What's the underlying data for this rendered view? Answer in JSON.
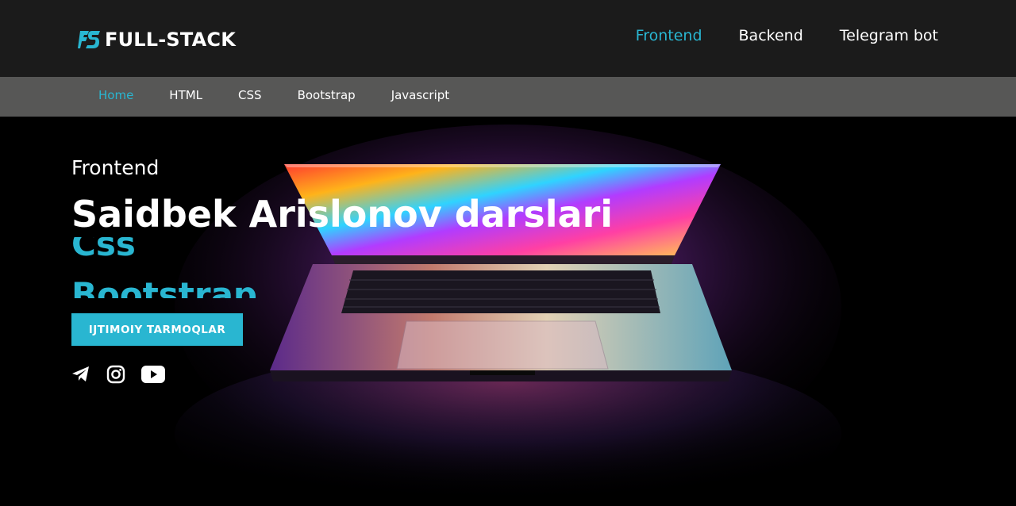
{
  "header": {
    "logo_text": "FULL-STACK",
    "logo_mark": "FS",
    "nav": [
      {
        "label": "Frontend",
        "active": true
      },
      {
        "label": "Backend",
        "active": false
      },
      {
        "label": "Telegram bot",
        "active": false
      }
    ]
  },
  "subnav": {
    "items": [
      {
        "label": "Home",
        "active": true
      },
      {
        "label": "HTML",
        "active": false
      },
      {
        "label": "CSS",
        "active": false
      },
      {
        "label": "Bootstrap",
        "active": false
      },
      {
        "label": "Javascript",
        "active": false
      }
    ]
  },
  "hero": {
    "eyebrow": "Frontend",
    "title": "Saidbek Arislonov darslari",
    "rotating_words": [
      "Css",
      "Bootstrap"
    ],
    "cta_label": "IJTIMOIY TARMOQLAR",
    "socials": [
      {
        "icon": "telegram-icon"
      },
      {
        "icon": "instagram-icon"
      },
      {
        "icon": "youtube-icon"
      }
    ]
  },
  "colors": {
    "accent": "#29b6d1",
    "header_bg": "#1b1b1b",
    "subnav_bg": "#575756"
  }
}
